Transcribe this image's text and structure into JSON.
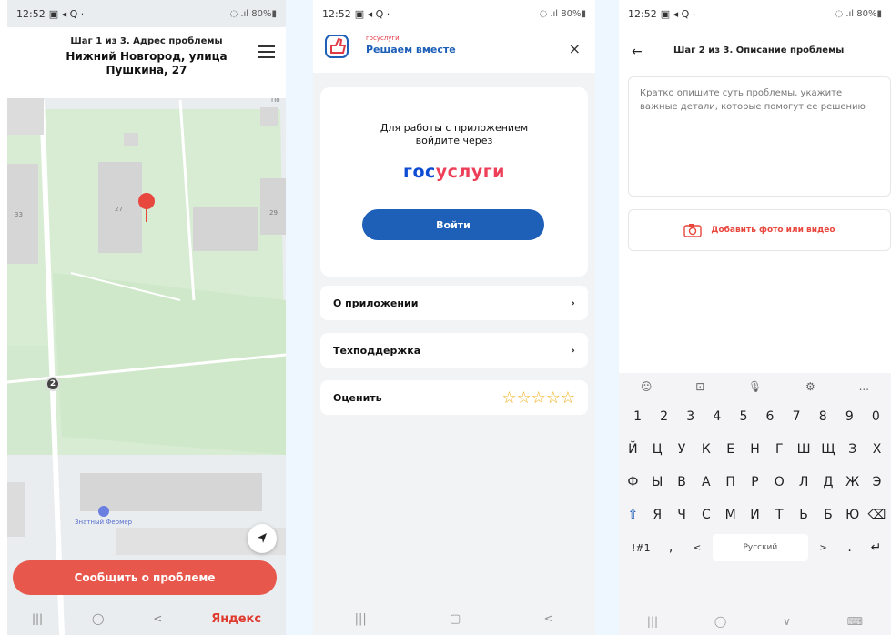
{
  "status": {
    "time": "12:52",
    "icons": "▣ ◂ Q ·",
    "signal": "◌ .ıl 80%▮"
  },
  "screen1": {
    "step": "Шаг 1 из 3. Адрес проблемы",
    "address": "Нижний Новгород, улица Пушкина, 27",
    "map_labels": {
      "b33": "33",
      "b27": "27",
      "b29": "29",
      "po": "По"
    },
    "poi_label": "Знатный Фермер",
    "marker_number": "2",
    "report_button": "Сообщить о проблеме",
    "nav": {
      "recent": "|||",
      "home": "◯",
      "back": "<",
      "brand": "Яндекс"
    }
  },
  "screen2": {
    "logo_small": "госуслуги",
    "logo_title": "Решаем вместе",
    "close": "×",
    "login_text": "Для работы с приложением войдите через",
    "gos_part1": "гос",
    "gos_part2": "услуги",
    "login_button": "Войти",
    "menu": [
      {
        "label": "О приложении",
        "chev": "›"
      },
      {
        "label": "Техподдержка",
        "chev": "›"
      },
      {
        "label": "Оценить",
        "stars": "☆☆☆☆☆"
      }
    ],
    "nav": {
      "recent": "|||",
      "home": "▢",
      "back": "<"
    }
  },
  "screen3": {
    "back": "←",
    "title": "Шаг 2 из 3. Описание проблемы",
    "desc_placeholder": "Кратко опишите суть проблемы, укажите важные детали, которые помогут ее решению",
    "photo_button": "Добавить фото или видео",
    "kb_tools": [
      "☺",
      "⊡",
      "🎙",
      "⚙",
      "..."
    ],
    "kb_rows": [
      [
        "1",
        "2",
        "3",
        "4",
        "5",
        "6",
        "7",
        "8",
        "9",
        "0"
      ],
      [
        "Й",
        "Ц",
        "У",
        "К",
        "Е",
        "Н",
        "Г",
        "Ш",
        "Щ",
        "З",
        "Х"
      ],
      [
        "Ф",
        "Ы",
        "В",
        "А",
        "П",
        "Р",
        "О",
        "Л",
        "Д",
        "Ж",
        "Э"
      ],
      [
        "⇧",
        "Я",
        "Ч",
        "С",
        "М",
        "И",
        "Т",
        "Ь",
        "Б",
        "Ю",
        "⌫"
      ]
    ],
    "kb_bottom": {
      "sym": "!#1",
      "comma": ",",
      "left": "<",
      "space": "Русский",
      "right": ">",
      "dot": ".",
      "enter": "↵"
    },
    "nav": {
      "recent": "|||",
      "home": "◯",
      "down": "∨",
      "kb": "⌨"
    }
  },
  "colors": {
    "accent_red": "#e8574c",
    "brand_blue": "#1e5fb8",
    "star": "#f2b01e"
  }
}
